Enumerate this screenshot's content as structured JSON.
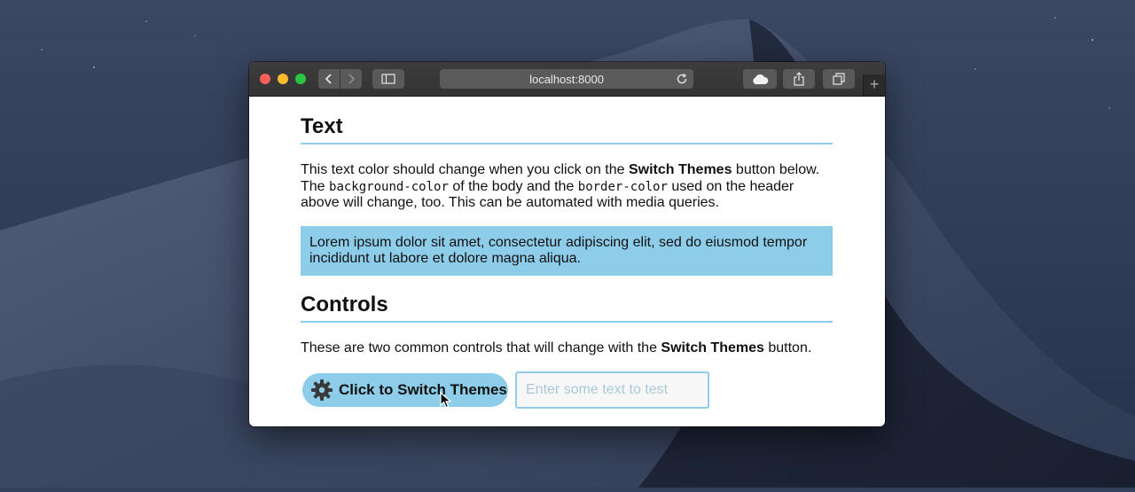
{
  "browser": {
    "url": "localhost:8000",
    "new_tab": "+"
  },
  "page": {
    "section_text": {
      "heading": "Text",
      "para_part1": "This text color should change when you click on the ",
      "para_bold": "Switch Themes",
      "para_part2": " button below. The ",
      "para_code1": "background-color",
      "para_part3": " of the body and the ",
      "para_code2": "border-color",
      "para_part4": " used on the header above will change, too. This can be automated with media queries.",
      "lorem": "Lorem ipsum dolor sit amet, consectetur adipiscing elit, sed do eiusmod tempor incididunt ut labore et dolore magna aliqua."
    },
    "section_controls": {
      "heading": "Controls",
      "para_part1": "These are two common controls that will change with the ",
      "para_bold": "Switch Themes",
      "para_part2": " button.",
      "button_label": "Click to Switch Themes",
      "input_placeholder": "Enter some text to test",
      "input_value": ""
    }
  },
  "colors": {
    "accent": "#8ecdea",
    "traffic_red": "#fe5f57",
    "traffic_yellow": "#febb2e",
    "traffic_green": "#29c840"
  },
  "icons": [
    "chevron-left-icon",
    "chevron-right-icon",
    "sidebar-icon",
    "reload-icon",
    "cloud-icon",
    "share-icon",
    "tabs-icon",
    "gear-icon",
    "mouse-cursor-icon"
  ]
}
